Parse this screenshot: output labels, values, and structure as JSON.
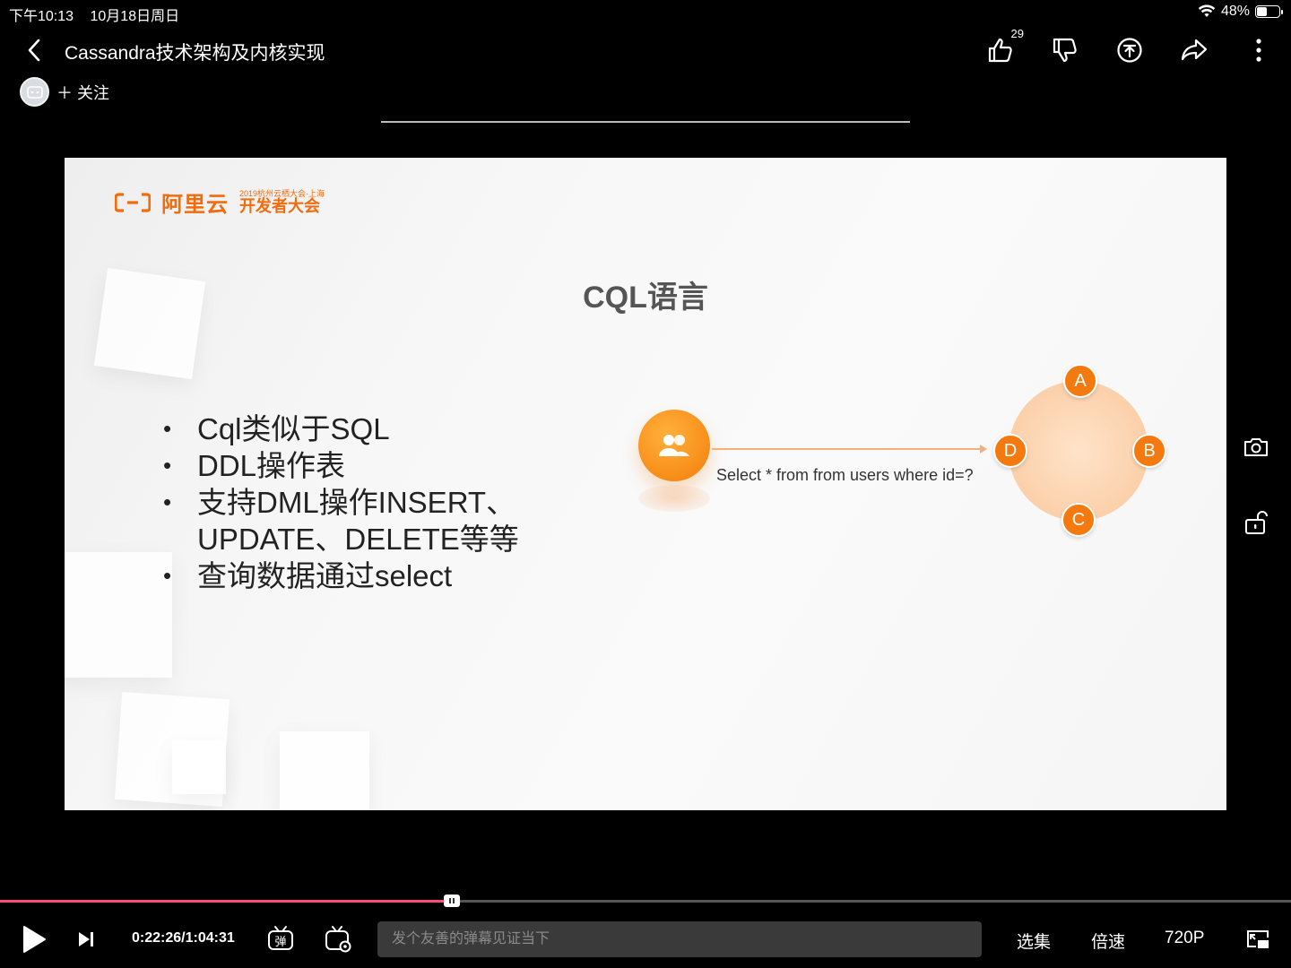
{
  "status_bar": {
    "time": "下午10:13",
    "date": "10月18日周日",
    "battery": "48%",
    "battery_level": 0.48
  },
  "header": {
    "title": "Cassandra技术架构及内核实现",
    "like_count": "29",
    "follow_label": "＋ 关注"
  },
  "slide": {
    "logo_main": "阿里云",
    "logo_small": "2019杭州云栖大会·上海",
    "logo_big": "开发者大会",
    "title": "CQL语言",
    "bullets": [
      "Cql类似于SQL",
      "DDL操作表",
      "支持DML操作INSERT、UPDATE、DELETE等等",
      "查询数据通过select"
    ],
    "query": "Select * from from users where id=?",
    "nodes": [
      "A",
      "B",
      "C",
      "D"
    ]
  },
  "player": {
    "progress": 0.35,
    "time": "0:22:26/1:04:31",
    "danmu_placeholder": "发个友善的弹幕见证当下",
    "episodes": "选集",
    "speed": "倍速",
    "quality": "720P",
    "danmu_toggle_icon": "弹"
  }
}
